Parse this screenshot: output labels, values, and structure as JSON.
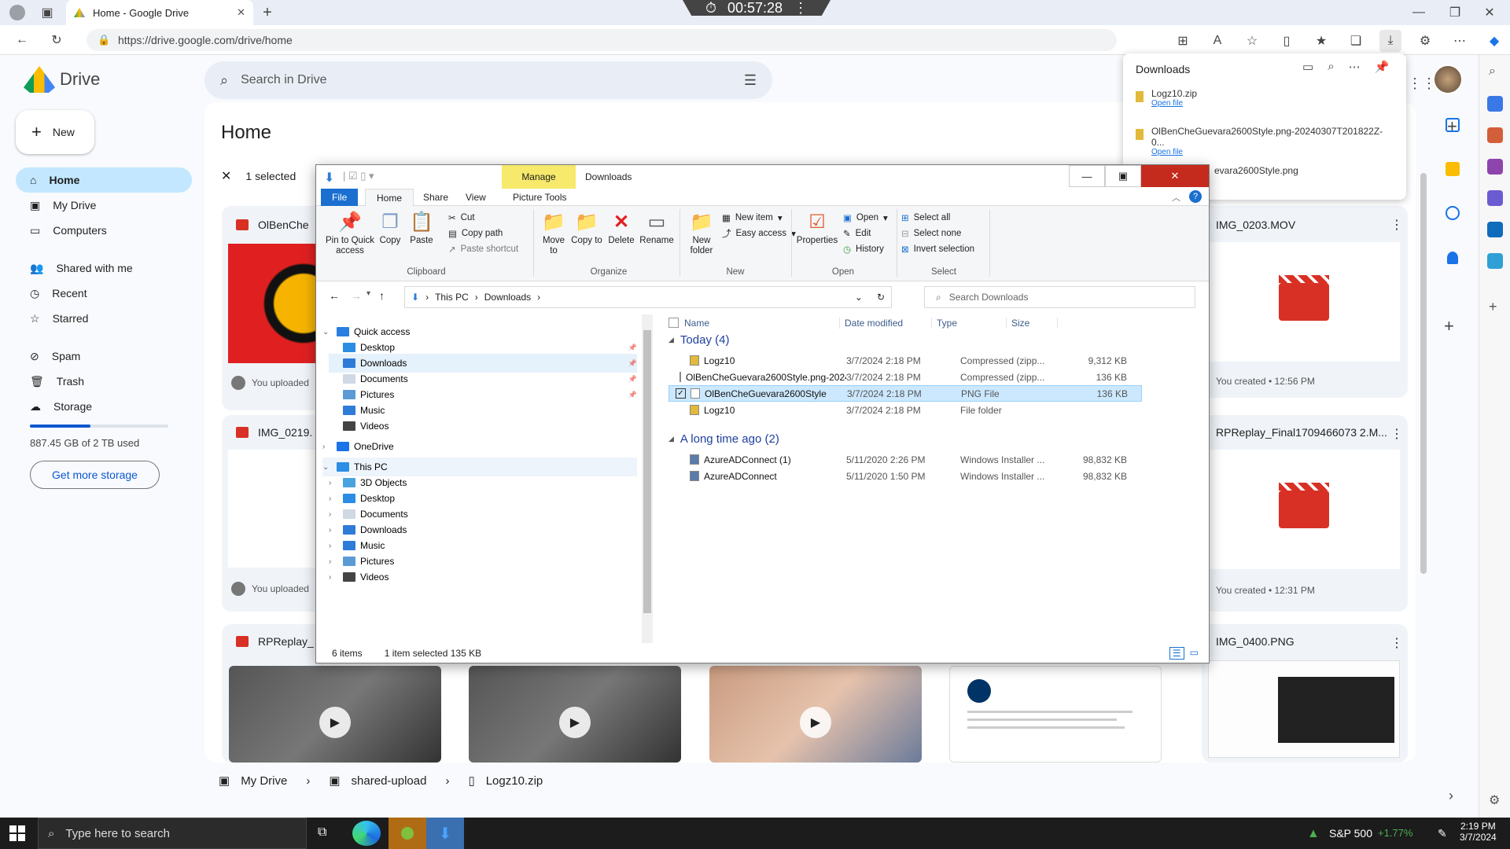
{
  "browser": {
    "tab_title": "Home - Google Drive",
    "url": "https://drive.google.com/drive/home",
    "timer": "00:57:28"
  },
  "drive": {
    "logo_text": "Drive",
    "search_placeholder": "Search in Drive",
    "new_label": "New",
    "page_title": "Home",
    "selected_text": "1 selected",
    "nav": [
      {
        "label": "Home"
      },
      {
        "label": "My Drive"
      },
      {
        "label": "Computers"
      },
      {
        "label": "Shared with me"
      },
      {
        "label": "Recent"
      },
      {
        "label": "Starred"
      },
      {
        "label": "Spam"
      },
      {
        "label": "Trash"
      },
      {
        "label": "Storage"
      }
    ],
    "storage_text": "887.45 GB of 2 TB used",
    "storage_fraction": 0.44,
    "get_storage_label": "Get more storage",
    "cards": [
      {
        "title": "OlBenChe",
        "meta": "You uploaded"
      },
      {
        "title": "IMG_0219.",
        "meta": "You uploaded"
      },
      {
        "title": "RPReplay_"
      },
      {
        "title": "IMG_0203.MOV",
        "meta": "You created • 12:56 PM"
      },
      {
        "title": "RPReplay_Final1709466073 2.M...",
        "meta": "You created • 12:31 PM"
      },
      {
        "title": "IMG_0400.PNG"
      }
    ],
    "breadcrumb": [
      "My Drive",
      "shared-upload",
      "Logz10.zip"
    ]
  },
  "downloads_panel": {
    "title": "Downloads",
    "items": [
      {
        "name": "Logz10.zip",
        "link": "Open file"
      },
      {
        "name": "OlBenCheGuevara2600Style.png-20240307T201822Z-0...",
        "link": "Open file"
      },
      {
        "name": "evara2600Style.png"
      }
    ]
  },
  "explorer": {
    "title_tab": "Manage",
    "title": "Downloads",
    "ribbon_tabs": [
      "File",
      "Home",
      "Share",
      "View",
      "Picture Tools"
    ],
    "clipboard": {
      "pin": "Pin to Quick access",
      "copy": "Copy",
      "paste": "Paste",
      "cut": "Cut",
      "copy_path": "Copy path",
      "paste_shortcut": "Paste shortcut",
      "group": "Clipboard"
    },
    "organize": {
      "move_to": "Move to",
      "copy_to": "Copy to",
      "delete": "Delete",
      "rename": "Rename",
      "group": "Organize"
    },
    "new_group": {
      "new_folder": "New folder",
      "new_item": "New item",
      "easy_access": "Easy access",
      "group": "New"
    },
    "open_group": {
      "properties": "Properties",
      "open": "Open",
      "edit": "Edit",
      "history": "History",
      "group": "Open"
    },
    "select_group": {
      "select_all": "Select all",
      "select_none": "Select none",
      "invert": "Invert selection",
      "group": "Select"
    },
    "path": [
      "This PC",
      "Downloads"
    ],
    "search_placeholder": "Search Downloads",
    "tree": [
      {
        "label": "Quick access",
        "level": 0,
        "color": "#2a7de1"
      },
      {
        "label": "Desktop",
        "level": 1,
        "color": "#2b8de3"
      },
      {
        "label": "Downloads",
        "level": 1,
        "color": "#2f7bd8"
      },
      {
        "label": "Documents",
        "level": 1,
        "color": "#cfd8e3"
      },
      {
        "label": "Pictures",
        "level": 1,
        "color": "#5a9bd5"
      },
      {
        "label": "Music",
        "level": 1,
        "color": "#2f7bd8"
      },
      {
        "label": "Videos",
        "level": 1,
        "color": "#444"
      },
      {
        "label": "OneDrive",
        "level": 0,
        "color": "#1a73e8"
      },
      {
        "label": "This PC",
        "level": 0,
        "color": "#2b8de3"
      },
      {
        "label": "3D Objects",
        "level": 1,
        "color": "#4aa3df"
      },
      {
        "label": "Desktop",
        "level": 1,
        "color": "#2b8de3"
      },
      {
        "label": "Documents",
        "level": 1,
        "color": "#cfd8e3"
      },
      {
        "label": "Downloads",
        "level": 1,
        "color": "#2f7bd8"
      },
      {
        "label": "Music",
        "level": 1,
        "color": "#2f7bd8"
      },
      {
        "label": "Pictures",
        "level": 1,
        "color": "#5a9bd5"
      },
      {
        "label": "Videos",
        "level": 1,
        "color": "#444"
      }
    ],
    "columns": [
      "Name",
      "Date modified",
      "Type",
      "Size"
    ],
    "groups": [
      {
        "label": "Today (4)",
        "rows": [
          {
            "name": "Logz10",
            "date": "3/7/2024 2:18 PM",
            "type": "Compressed (zipp...",
            "size": "9,312 KB",
            "icon": "zip"
          },
          {
            "name": "OlBenCheGuevara2600Style.png-2024...",
            "date": "3/7/2024 2:18 PM",
            "type": "Compressed (zipp...",
            "size": "136 KB",
            "icon": "zip"
          },
          {
            "name": "OlBenCheGuevara2600Style",
            "date": "3/7/2024 2:18 PM",
            "type": "PNG File",
            "size": "136 KB",
            "icon": "png",
            "selected": true
          },
          {
            "name": "Logz10",
            "date": "3/7/2024 2:18 PM",
            "type": "File folder",
            "size": "",
            "icon": "folder"
          }
        ]
      },
      {
        "label": "A long time ago (2)",
        "rows": [
          {
            "name": "AzureADConnect (1)",
            "date": "5/11/2020 2:26 PM",
            "type": "Windows Installer ...",
            "size": "98,832 KB",
            "icon": "msi"
          },
          {
            "name": "AzureADConnect",
            "date": "5/11/2020 1:50 PM",
            "type": "Windows Installer ...",
            "size": "98,832 KB",
            "icon": "msi"
          }
        ]
      }
    ],
    "status": {
      "items": "6 items",
      "selected": "1 item selected  135 KB"
    }
  },
  "taskbar": {
    "search_placeholder": "Type here to search",
    "ticker_name": "S&P 500",
    "ticker_change": "+1.77%",
    "time": "2:19 PM",
    "date": "3/7/2024"
  },
  "colors": {
    "accent": "#0b57d0",
    "selected_nav": "#c2e7ff",
    "drive_red": "#d93025"
  }
}
